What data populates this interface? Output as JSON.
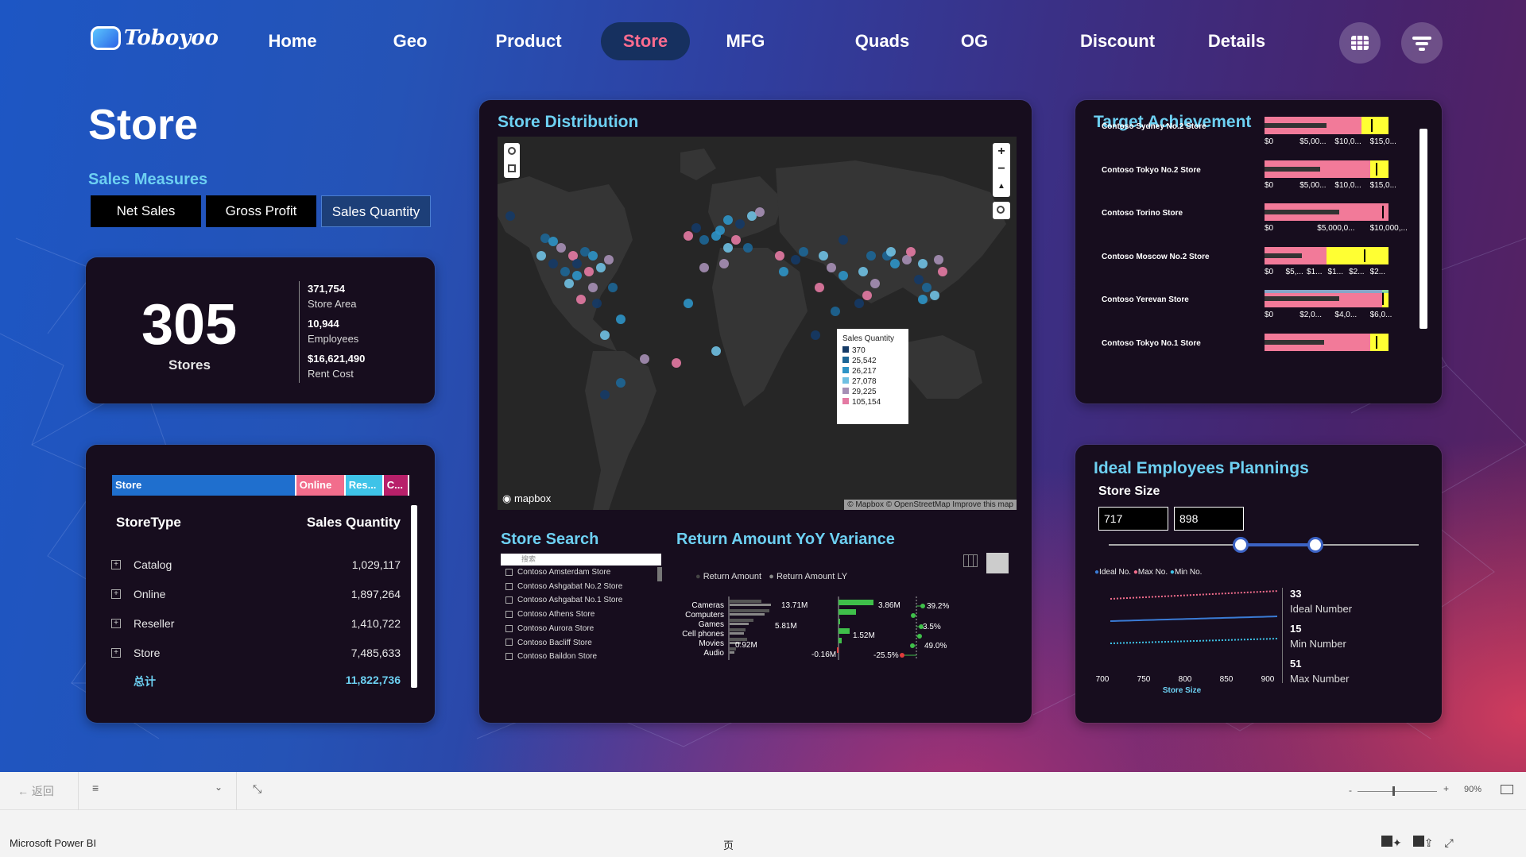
{
  "app": {
    "logo": "Toboyoo",
    "window_title": "Microsoft Power BI",
    "page_label": "页"
  },
  "nav": [
    {
      "label": "Home"
    },
    {
      "label": "Geo"
    },
    {
      "label": "Product"
    },
    {
      "label": "Store",
      "active": true
    },
    {
      "label": "MFG"
    },
    {
      "label": "Quads"
    },
    {
      "label": "OG"
    },
    {
      "label": "Discount"
    },
    {
      "label": "Details"
    }
  ],
  "page": {
    "title": "Store",
    "sales_measures": "Sales Measures",
    "buttons": [
      "Net Sales",
      "Gross Profit",
      "Sales Quantity"
    ],
    "selected_button": "Sales Quantity"
  },
  "kpi": {
    "stores": "305",
    "stores_label": "Stores",
    "store_area": "371,754",
    "store_area_label": "Store Area",
    "employees": "10,944",
    "employees_label": "Employees",
    "rent_cost": "$16,621,490",
    "rent_cost_label": "Rent Cost"
  },
  "storetype": {
    "stacked": [
      {
        "label": "Store",
        "share": 0.645,
        "color": "#1f6fce"
      },
      {
        "label": "Online",
        "share": 0.16,
        "color": "#f26d8c"
      },
      {
        "label": "Res...",
        "share": 0.12,
        "color": "#3ec3e8"
      },
      {
        "label": "C...",
        "share": 0.075,
        "color": "#b8206a"
      }
    ],
    "col_type": "StoreType",
    "col_qty": "Sales Quantity",
    "rows": [
      {
        "name": "Catalog",
        "qty": "1,029,117"
      },
      {
        "name": "Online",
        "qty": "1,897,264"
      },
      {
        "name": "Reseller",
        "qty": "1,410,722"
      },
      {
        "name": "Store",
        "qty": "7,485,633"
      }
    ],
    "total_label": "总计",
    "total": "11,822,736"
  },
  "map": {
    "title": "Store Distribution",
    "legend_title": "Sales Quantity",
    "legend": [
      {
        "v": "370",
        "c": "#153a66"
      },
      {
        "v": "25,542",
        "c": "#1d6696"
      },
      {
        "v": "26,217",
        "c": "#2e94c6"
      },
      {
        "v": "27,078",
        "c": "#6fc0e2"
      },
      {
        "v": "29,225",
        "c": "#a68fb5"
      },
      {
        "v": "105,154",
        "c": "#e47aa3"
      }
    ],
    "brand": "mapbox",
    "attribution": "© Mapbox © OpenStreetMap",
    "improve": "Improve this map"
  },
  "target": {
    "title": "Target Achievement",
    "stores": [
      {
        "name": "Contoso Sydney No.2 Store",
        "ticks": [
          "$0",
          "$5,00...",
          "$10,0...",
          "$15,0..."
        ]
      },
      {
        "name": "Contoso Tokyo No.2 Store",
        "ticks": [
          "$0",
          "$5,00...",
          "$10,0...",
          "$15,0..."
        ]
      },
      {
        "name": "Contoso Torino Store",
        "ticks": [
          "$0",
          "$5,000,0...",
          "$10,000,..."
        ]
      },
      {
        "name": "Contoso Moscow No.2 Store",
        "ticks": [
          "$0",
          "$5,...",
          "$1...",
          "$1...",
          "$2...",
          "$2..."
        ]
      },
      {
        "name": "Contoso Yerevan Store",
        "ticks": [
          "$0",
          "$2,0...",
          "$4,0...",
          "$6,0..."
        ]
      },
      {
        "name": "Contoso Tokyo No.1 Store",
        "ticks": []
      }
    ]
  },
  "search": {
    "title": "Store Search",
    "placeholder": "搜索",
    "items": [
      "Contoso Amsterdam Store",
      "Contoso Ashgabat No.2 Store",
      "Contoso Ashgabat No.1 Store",
      "Contoso Athens Store",
      "Contoso Aurora Store",
      "Contoso Bacliff Store",
      "Contoso Baildon Store"
    ]
  },
  "yoy": {
    "title": "Return Amount YoY Variance",
    "legend": [
      "Return Amount",
      "Return Amount LY"
    ],
    "categories": [
      "Cameras",
      "Computers",
      "Games",
      "Cell phones",
      "Movies",
      "Audio"
    ],
    "labels_a": [
      "13.71M",
      "5.81M",
      "0.92M"
    ],
    "labels_b": [
      "3.86M",
      "1.52M",
      "-0.16M"
    ],
    "labels_c": [
      "39.2%",
      "3.5%",
      "49.0%",
      "-25.5%"
    ]
  },
  "plan": {
    "title": "Ideal Employees Plannings",
    "store_size_label": "Store Size",
    "min": "717",
    "max": "898",
    "legend": [
      "Ideal No.",
      "Max No.",
      "Min No."
    ],
    "x_ticks": [
      "700",
      "750",
      "800",
      "850",
      "900"
    ],
    "x_title": "Store Size",
    "ideal": "33",
    "ideal_label": "Ideal Number",
    "min_n": "15",
    "min_label": "Min Number",
    "max_n": "51",
    "max_label": "Max Number"
  },
  "status": {
    "back": "返回",
    "zoom": "90%"
  }
}
